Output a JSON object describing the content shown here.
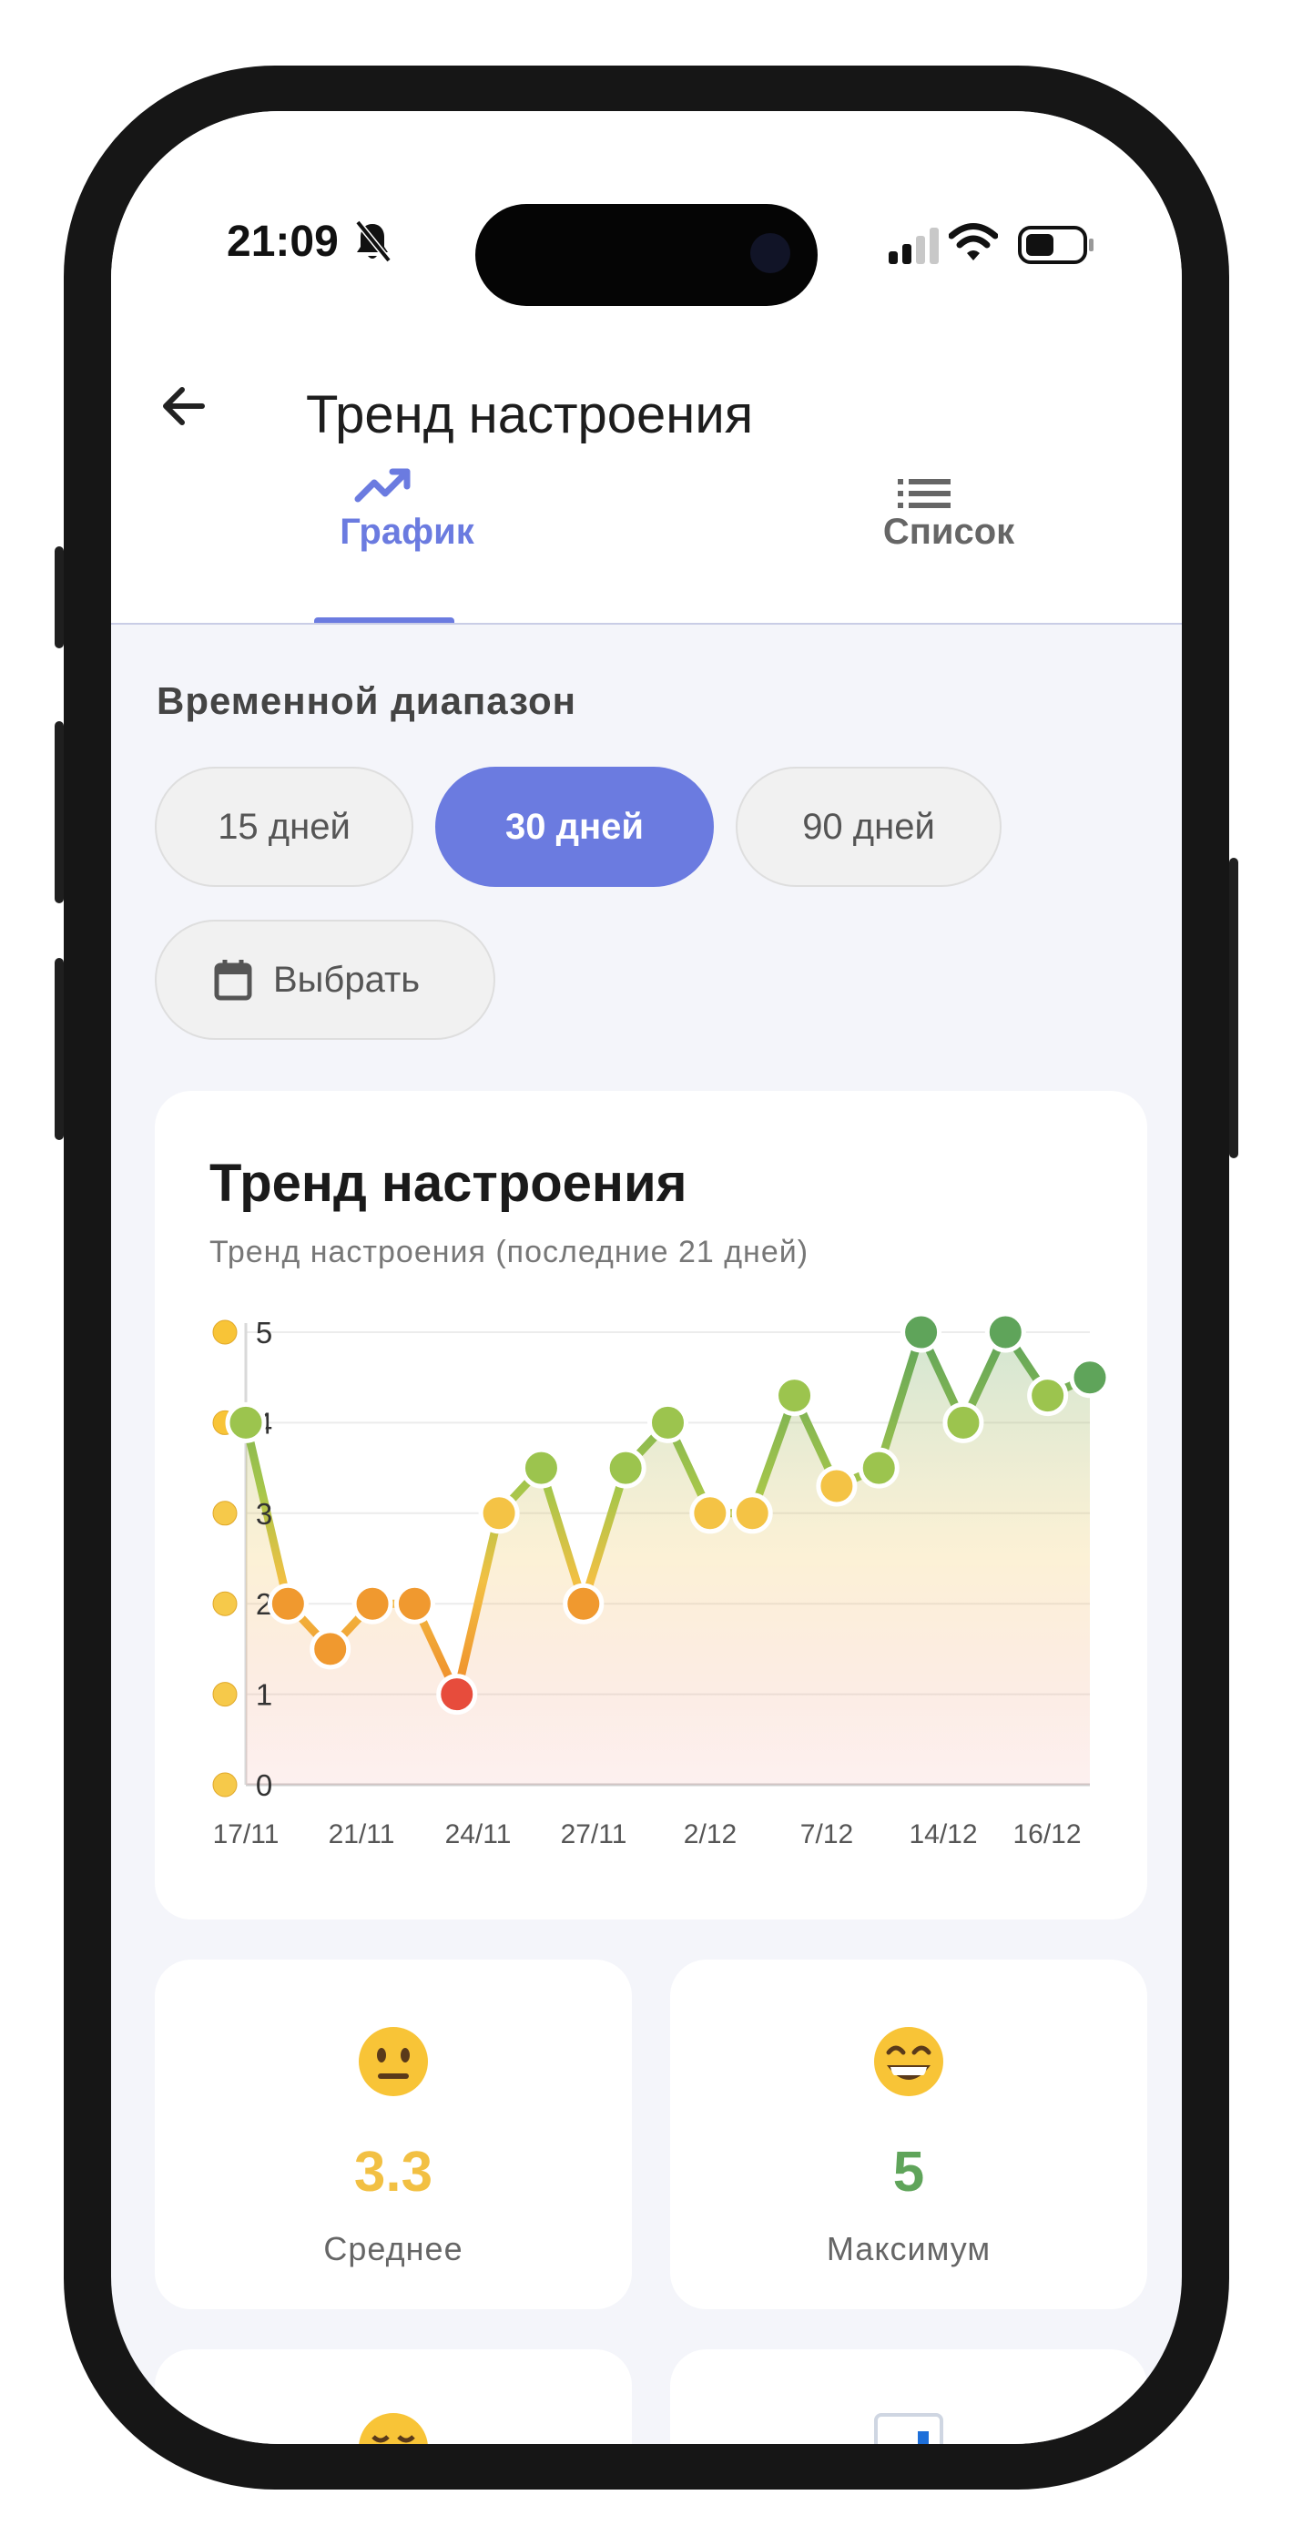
{
  "status_bar": {
    "time": "21:09"
  },
  "header": {
    "title": "Тренд настроения"
  },
  "tabs": [
    {
      "label": "График",
      "active": true
    },
    {
      "label": "Список",
      "active": false
    }
  ],
  "range": {
    "label": "Временной диапазон",
    "options": [
      "15 дней",
      "30 дней",
      "90 дней"
    ],
    "selected": "30 дней",
    "custom_label": "Выбрать"
  },
  "chart_card": {
    "title": "Тренд настроения",
    "subtitle": "Тренд настроения (последние 21 дней)"
  },
  "chart_data": {
    "type": "line",
    "title": "Тренд настроения",
    "subtitle": "Тренд настроения (последние 21 дней)",
    "y_ticks": [
      0,
      1,
      2,
      3,
      4,
      5
    ],
    "ylim": [
      0,
      5
    ],
    "x_tick_labels": [
      "17/11",
      "21/11",
      "24/11",
      "27/11",
      "2/12",
      "7/12",
      "14/12",
      "16/12"
    ],
    "values": [
      4,
      2,
      1.5,
      2,
      2,
      1,
      3,
      3.5,
      2,
      3.5,
      4,
      3,
      3,
      4.3,
      3.3,
      3.5,
      5,
      4,
      5,
      4.3,
      4.5
    ],
    "grid": true,
    "area_fill": true
  },
  "stats": [
    {
      "emoji": "neutral-face",
      "value": "3.3",
      "label": "Среднее",
      "color": "#f2c043"
    },
    {
      "emoji": "grinning-face",
      "value": "5",
      "label": "Максимум",
      "color": "#5fa45a"
    }
  ],
  "colors": {
    "accent": "#6b7be0",
    "mood_low": "#e74c3c",
    "mood_mid": "#f2c043",
    "mood_high": "#5fa45a"
  }
}
